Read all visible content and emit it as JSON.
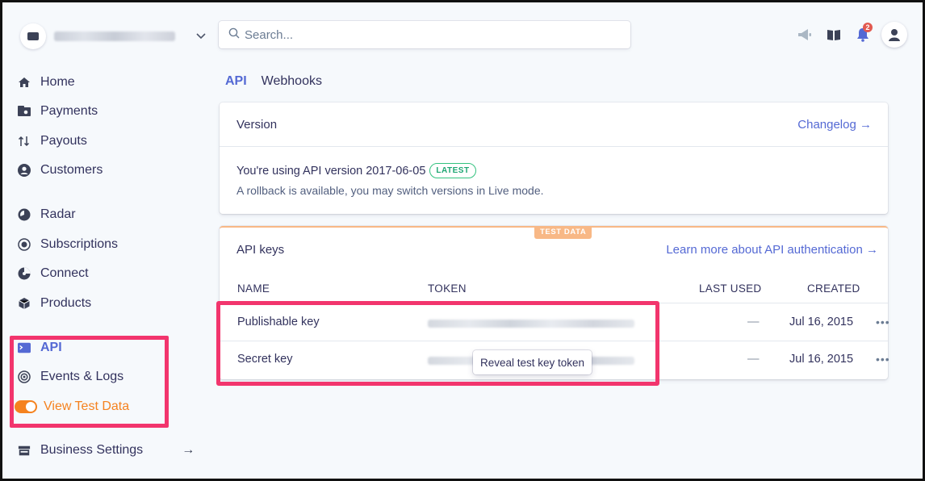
{
  "account": {
    "chevron": "chevron-down-icon"
  },
  "search": {
    "placeholder": "Search..."
  },
  "notifications": {
    "count": "2"
  },
  "sidebar": {
    "items": [
      {
        "label": "Home",
        "icon": "home-icon"
      },
      {
        "label": "Payments",
        "icon": "payments-icon"
      },
      {
        "label": "Payouts",
        "icon": "payouts-icon"
      },
      {
        "label": "Customers",
        "icon": "customers-icon"
      },
      {
        "label": "Radar",
        "icon": "radar-icon"
      },
      {
        "label": "Subscriptions",
        "icon": "subscriptions-icon"
      },
      {
        "label": "Connect",
        "icon": "connect-icon"
      },
      {
        "label": "Products",
        "icon": "products-icon"
      },
      {
        "label": "API",
        "icon": "api-icon",
        "active": true
      },
      {
        "label": "Events & Logs",
        "icon": "events-icon"
      },
      {
        "label": "View Test Data",
        "icon": "toggle-icon"
      },
      {
        "label": "Business Settings",
        "icon": "business-icon"
      }
    ],
    "settings_arrow": "→"
  },
  "tabs": [
    {
      "label": "API",
      "active": true
    },
    {
      "label": "Webhooks",
      "active": false
    }
  ],
  "version_card": {
    "title": "Version",
    "link": "Changelog →",
    "version_text": "You're using API version 2017-06-05",
    "badge": "LATEST",
    "rollback": "A rollback is available, you may switch versions in Live mode."
  },
  "keys_card": {
    "badge": "TEST DATA",
    "title": "API keys",
    "link": "Learn more about API authentication →",
    "columns": [
      "NAME",
      "TOKEN",
      "LAST USED",
      "CREATED"
    ],
    "rows": [
      {
        "name": "Publishable key",
        "last_used": "—",
        "created": "Jul 16, 2015",
        "more": "•••"
      },
      {
        "name": "Secret key",
        "last_used": "—",
        "created": "Jul 16, 2015",
        "more": "•••"
      }
    ],
    "tooltip": "Reveal test key token"
  },
  "colors": {
    "accent": "#5469d4",
    "test": "#f5821f",
    "highlight": "#f2356d"
  }
}
